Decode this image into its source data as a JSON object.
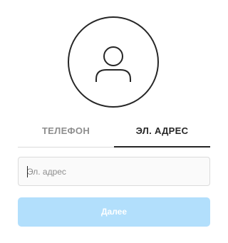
{
  "avatar": {
    "icon": "user-icon"
  },
  "tabs": [
    {
      "label": "ТЕЛЕФОН",
      "active": false
    },
    {
      "label": "ЭЛ. АДРЕС",
      "active": true
    }
  ],
  "email_input": {
    "value": "",
    "placeholder": "Эл. адрес"
  },
  "next_button": {
    "label": "Далее",
    "disabled": true
  },
  "colors": {
    "text_primary": "#262626",
    "text_secondary": "#8e8e8e",
    "border": "#dbdbdb",
    "input_background": "#fafafa",
    "button_disabled": "#b2dffc"
  }
}
